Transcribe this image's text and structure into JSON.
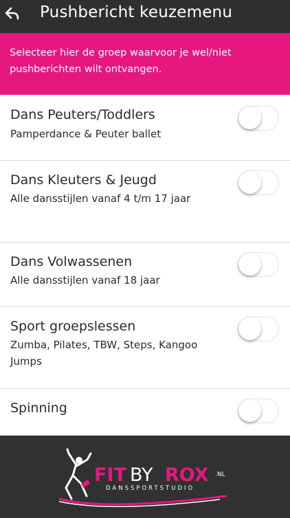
{
  "header": {
    "title": "Pushbericht keuzemenu",
    "back_icon": "back-arrow-icon"
  },
  "banner": {
    "text": "Selecteer hier de groep waarvoor je wel/niet pushberichten wilt ontvangen.",
    "color": "#e6177f"
  },
  "items": [
    {
      "title": "Dans Peuters/Toddlers",
      "subtitle": "Pamperdance & Peuter ballet",
      "enabled": false
    },
    {
      "title": "Dans Kleuters & Jeugd",
      "subtitle": "Alle dansstijlen vanaf 4 t/m 17 jaar",
      "enabled": false
    },
    {
      "title": "Dans Volwassenen",
      "subtitle": "Alle dansstijlen vanaf 18 jaar",
      "enabled": false
    },
    {
      "title": "Sport groepslessen",
      "subtitle": "Zumba, Pilates, TBW, Steps, Kangoo Jumps",
      "enabled": false
    },
    {
      "title": "Spinning",
      "subtitle": "",
      "enabled": false
    }
  ],
  "logo": {
    "fit": "FIT",
    "by": "BY",
    "rox": "ROX",
    "nl": ".NL",
    "tagline": "DANSSPORTSTUDIO",
    "accent": "#e6177f"
  }
}
